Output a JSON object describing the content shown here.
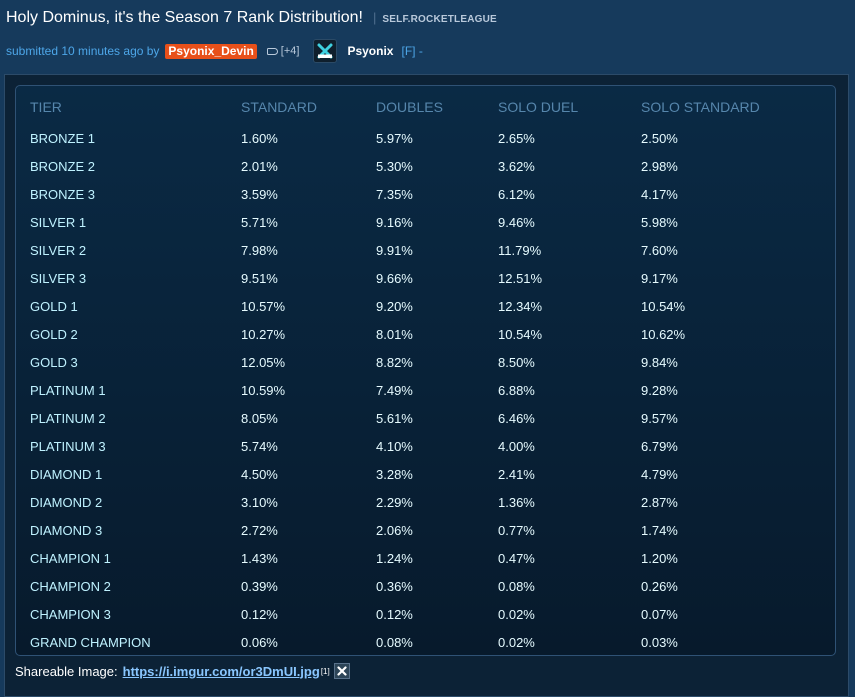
{
  "post": {
    "title": "Holy Dominus, it's the Season 7 Rank Distribution!",
    "separator": "|",
    "domain": "SELF.ROCKETLEAGUE",
    "tagline": {
      "submitted_text": "submitted 10 minutes ago by",
      "author": "Psyonix_Devin",
      "karma": "[+4]",
      "flair_icon": "psyonix-logo-icon",
      "flair_name": "Psyonix",
      "frontpage_tag": "[F] -"
    }
  },
  "table": {
    "columns": [
      "TIER",
      "STANDARD",
      "DOUBLES",
      "SOLO DUEL",
      "SOLO STANDARD"
    ],
    "rows": [
      [
        "BRONZE 1",
        "1.60%",
        "5.97%",
        "2.65%",
        "2.50%"
      ],
      [
        "BRONZE 2",
        "2.01%",
        "5.30%",
        "3.62%",
        "2.98%"
      ],
      [
        "BRONZE 3",
        "3.59%",
        "7.35%",
        "6.12%",
        "4.17%"
      ],
      [
        "SILVER 1",
        "5.71%",
        "9.16%",
        "9.46%",
        "5.98%"
      ],
      [
        "SILVER 2",
        "7.98%",
        "9.91%",
        "11.79%",
        "7.60%"
      ],
      [
        "SILVER 3",
        "9.51%",
        "9.66%",
        "12.51%",
        "9.17%"
      ],
      [
        "GOLD 1",
        "10.57%",
        "9.20%",
        "12.34%",
        "10.54%"
      ],
      [
        "GOLD 2",
        "10.27%",
        "8.01%",
        "10.54%",
        "10.62%"
      ],
      [
        "GOLD 3",
        "12.05%",
        "8.82%",
        "8.50%",
        "9.84%"
      ],
      [
        "PLATINUM 1",
        "10.59%",
        "7.49%",
        "6.88%",
        "9.28%"
      ],
      [
        "PLATINUM 2",
        "8.05%",
        "5.61%",
        "6.46%",
        "9.57%"
      ],
      [
        "PLATINUM 3",
        "5.74%",
        "4.10%",
        "4.00%",
        "6.79%"
      ],
      [
        "DIAMOND 1",
        "4.50%",
        "3.28%",
        "2.41%",
        "4.79%"
      ],
      [
        "DIAMOND 2",
        "3.10%",
        "2.29%",
        "1.36%",
        "2.87%"
      ],
      [
        "DIAMOND 3",
        "2.72%",
        "2.06%",
        "0.77%",
        "1.74%"
      ],
      [
        "CHAMPION 1",
        "1.43%",
        "1.24%",
        "0.47%",
        "1.20%"
      ],
      [
        "CHAMPION 2",
        "0.39%",
        "0.36%",
        "0.08%",
        "0.26%"
      ],
      [
        "CHAMPION 3",
        "0.12%",
        "0.12%",
        "0.02%",
        "0.07%"
      ],
      [
        "GRAND CHAMPION",
        "0.06%",
        "0.08%",
        "0.02%",
        "0.03%"
      ]
    ]
  },
  "shareable": {
    "label": "Shareable Image:",
    "link": "https://i.imgur.com/or3DmUI.jpg",
    "footnote": "[1]",
    "close_icon": "close-icon"
  },
  "colors": {
    "page_bg": "#163a5c",
    "author_bg": "#e8501a",
    "link": "#4da6e8",
    "header_text": "#5686ac",
    "tier_text": "#bff2ff"
  }
}
